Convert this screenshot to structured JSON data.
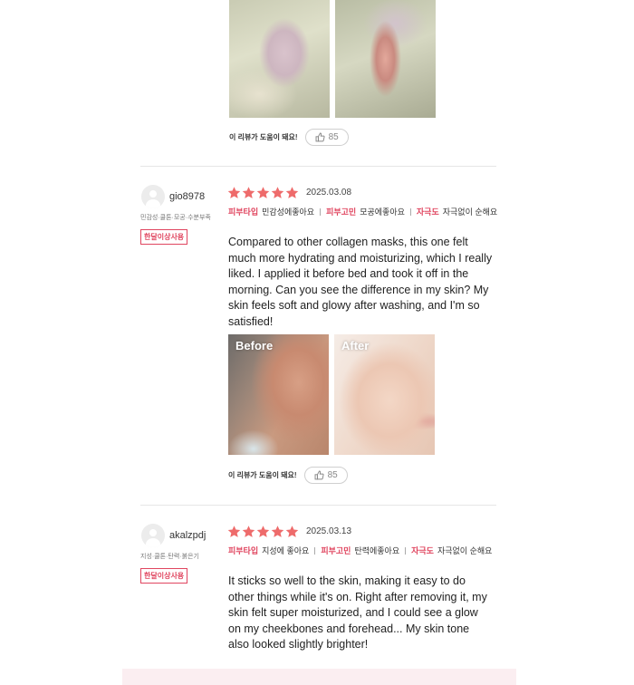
{
  "helpful_question": "이 리뷰가 도움이 돼요!",
  "top_review": {
    "helpful_count": "85",
    "photos": [
      "collagen-gel-on-hand",
      "collagen-gel-between-fingers"
    ]
  },
  "reviews": [
    {
      "username": "gio8978",
      "skin_profile": "민감성·쿨톤·모공·수분부족",
      "badge": "한달이상사용",
      "rating": 5,
      "date": "2025.03.08",
      "tags": [
        {
          "key": "피부타입",
          "value": "민감성에좋아요"
        },
        {
          "key": "피부고민",
          "value": "모공에좋아요"
        },
        {
          "key": "자극도",
          "value": "자극없이 순해요"
        }
      ],
      "text": "Compared to other collagen masks, this one felt much more hydrating and moisturizing, which I really liked. I applied it before bed and took it off in the morning. Can you see the difference in my skin? My skin feels soft and glowy after washing, and I'm so satisfied!",
      "photos": [
        {
          "label": "Before"
        },
        {
          "label": "After"
        }
      ],
      "helpful_count": "85"
    },
    {
      "username": "akalzpdj",
      "skin_profile": "지성·쿨톤·탄력·붉은기",
      "badge": "한달이상사용",
      "rating": 5,
      "date": "2025.03.13",
      "tags": [
        {
          "key": "피부타입",
          "value": "지성에 좋아요"
        },
        {
          "key": "피부고민",
          "value": "탄력에좋아요"
        },
        {
          "key": "자극도",
          "value": "자극없이 순해요"
        }
      ],
      "text": "It sticks so well to the skin, making it easy to do other things while it's on. Right after removing it, my skin felt super moisturized, and I could see a glow on my cheekbones and forehead... My skin tone also looked slightly brighter!"
    }
  ],
  "colors": {
    "accent": "#e0455f",
    "star": "#ee6b6b",
    "band": "#fbeef1"
  }
}
